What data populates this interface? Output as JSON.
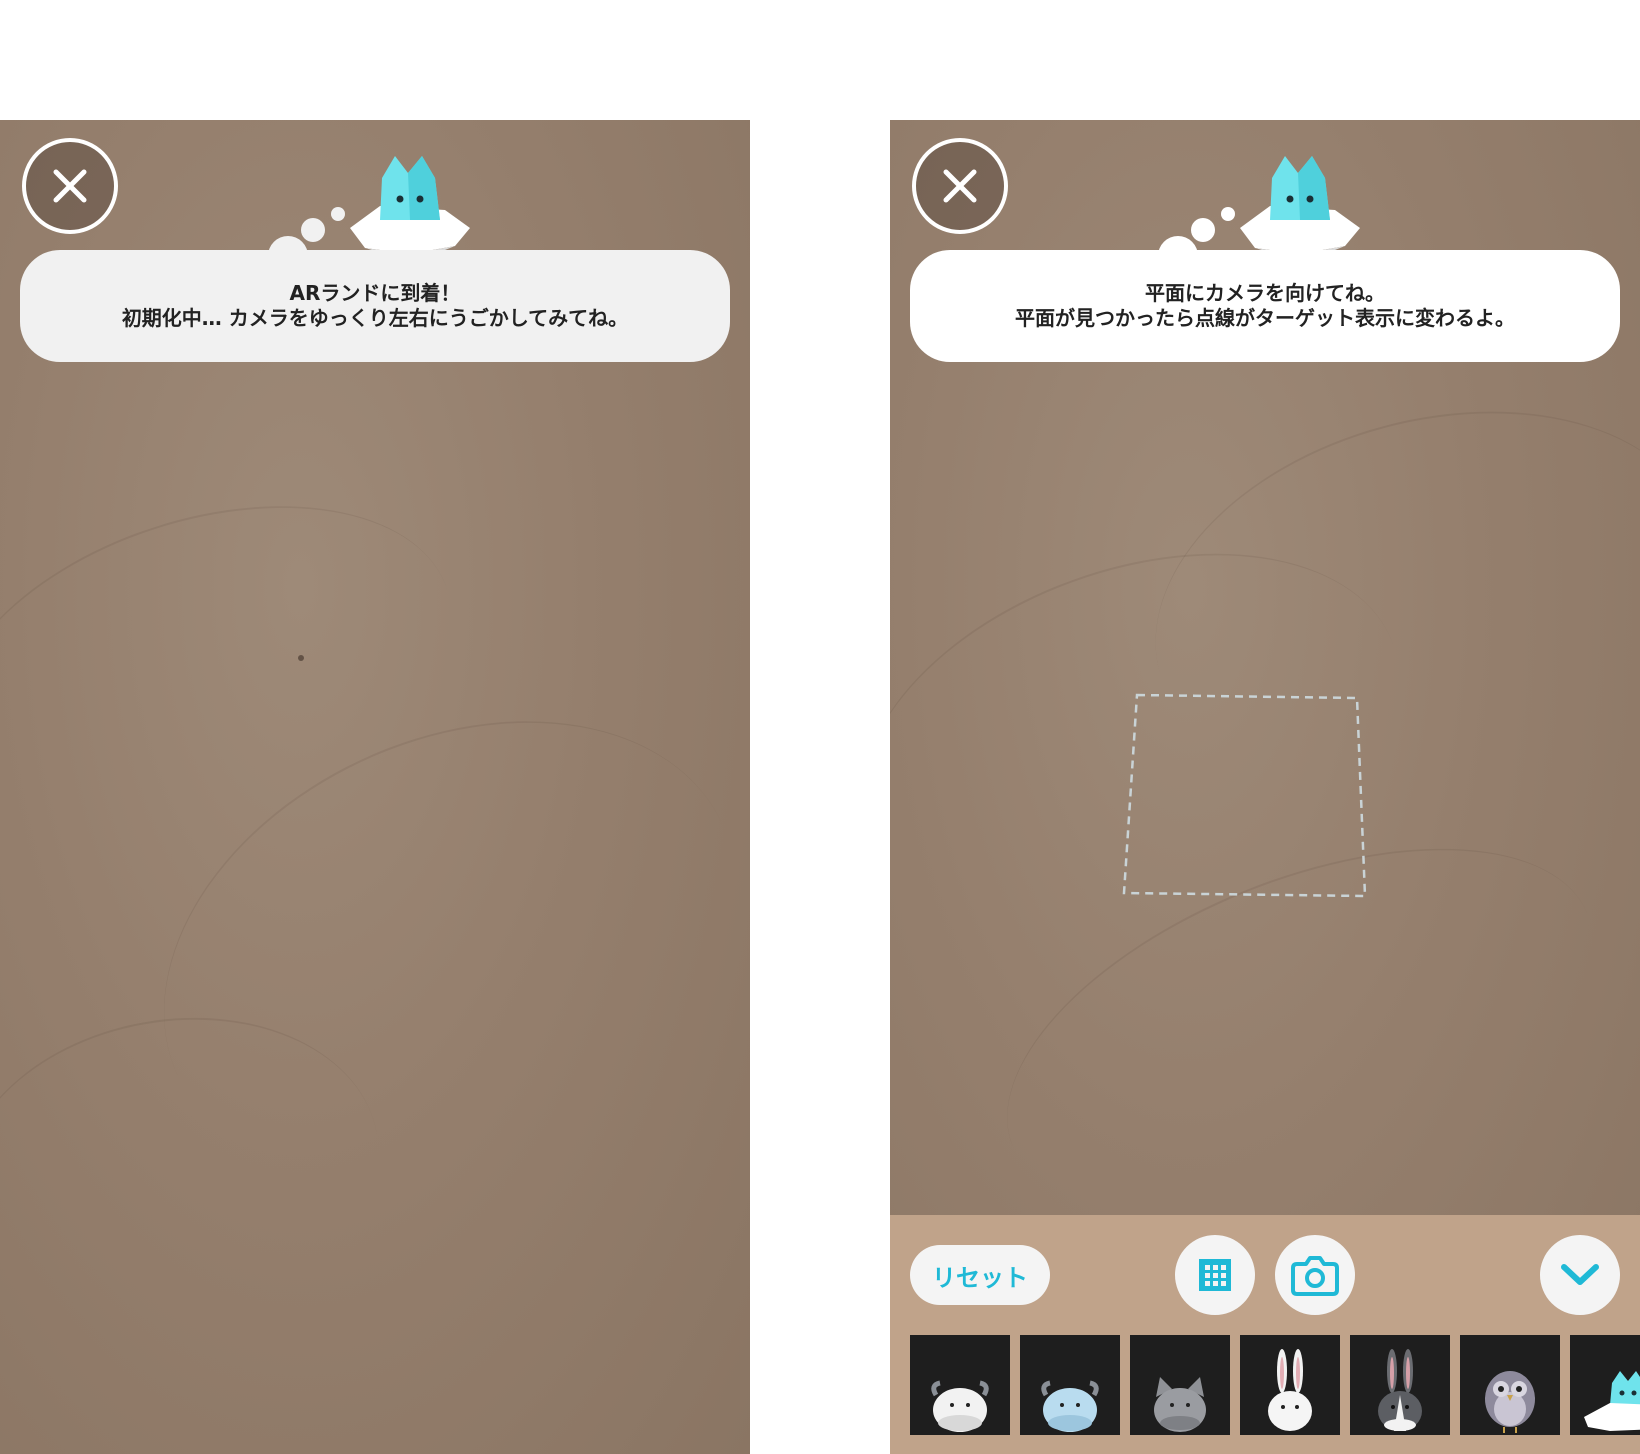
{
  "left_screen": {
    "close_icon": "close-icon",
    "mascot_icon": "cat-on-cloud-icon",
    "message": {
      "line1": "ARランドに到着！",
      "line2": "初期化中… カメラをゆっくり左右にうごかしてみてね。"
    }
  },
  "right_screen": {
    "close_icon": "close-icon",
    "mascot_icon": "cat-on-cloud-icon",
    "message": {
      "line1": "平面にカメラを向けてね。",
      "line2": "平面が見つかったら点線がターゲット表示に変わるよ。"
    },
    "toolbar": {
      "reset_label": "リセット",
      "grid_icon": "grid-icon",
      "camera_icon": "camera-icon",
      "collapse_icon": "chevron-down-icon"
    },
    "characters": [
      {
        "name": "white-yak-icon"
      },
      {
        "name": "blue-yak-icon"
      },
      {
        "name": "gray-cat-icon"
      },
      {
        "name": "white-rabbit-icon"
      },
      {
        "name": "dutch-rabbit-icon"
      },
      {
        "name": "owl-icon"
      },
      {
        "name": "cat-on-cloud-icon"
      }
    ]
  },
  "colors": {
    "accent": "#1fb9d6",
    "toolbar_bg": "#c0a38a",
    "bubble_bg": "#f1f1f1",
    "mascot": "#6fe3ec"
  }
}
